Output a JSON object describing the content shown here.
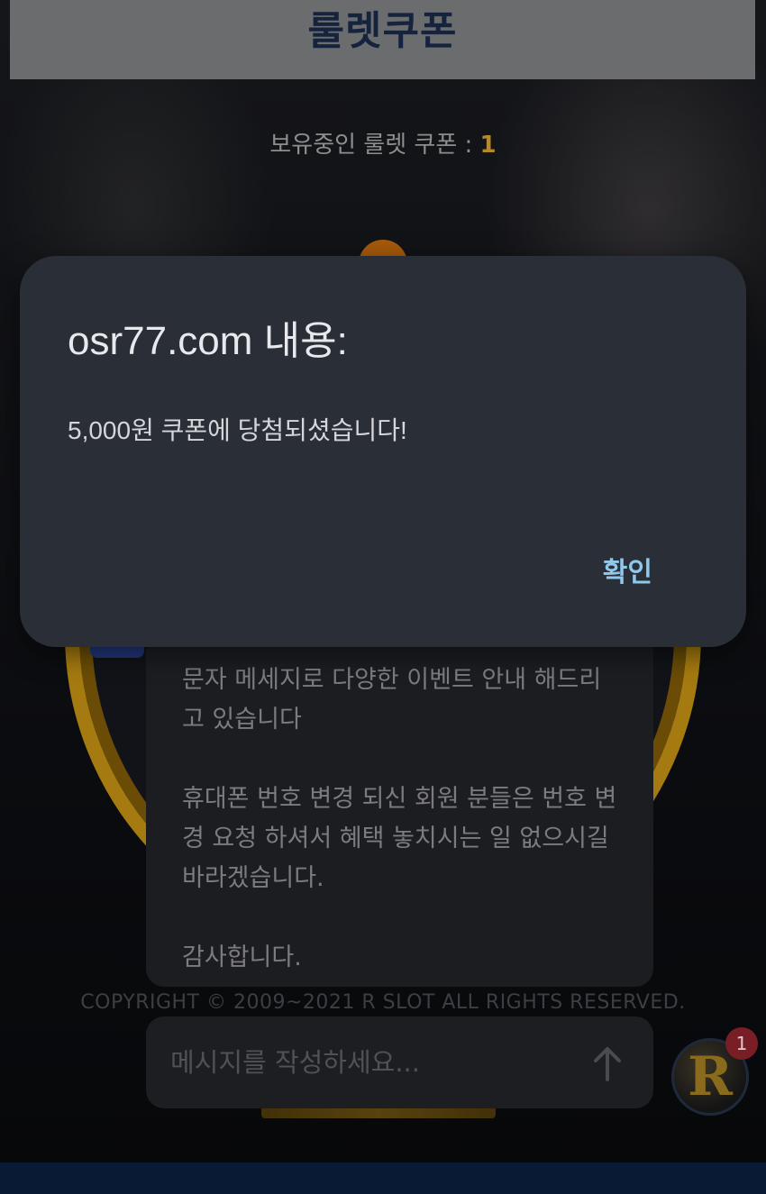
{
  "header": {
    "title": "룰렛쿠폰"
  },
  "coupon_status": {
    "label": "보유중인 룰렛 쿠폰 : ",
    "count": "1"
  },
  "chat": {
    "paragraphs": [
      "문자 메세지로 다양한 이벤트 안내 해드리고 있습니다",
      "휴대폰 번호 변경 되신 회원 분들은 번호 변경 요청 하셔서 혜택 놓치시는 일 없으시길 바라겠습니다.",
      "감사합니다."
    ],
    "composer_placeholder": "메시지를 작성하세요..."
  },
  "footer": {
    "copyright": "COPYRIGHT © 2009~2021 R SLOT ALL RIGHTS RESERVED."
  },
  "avatar": {
    "letter": "R",
    "badge_count": "1"
  },
  "dialog": {
    "title": "osr77.com 내용:",
    "message": "5,000원 쿠폰에 당첨되셨습니다!",
    "ok_label": "확인"
  },
  "colors": {
    "accent_gold": "#b5892b",
    "dialog_bg": "#2a2e36",
    "dialog_button": "#8fc8ec",
    "badge_red": "#7a1e26"
  },
  "icons": {
    "send": "arrow-up-icon"
  }
}
